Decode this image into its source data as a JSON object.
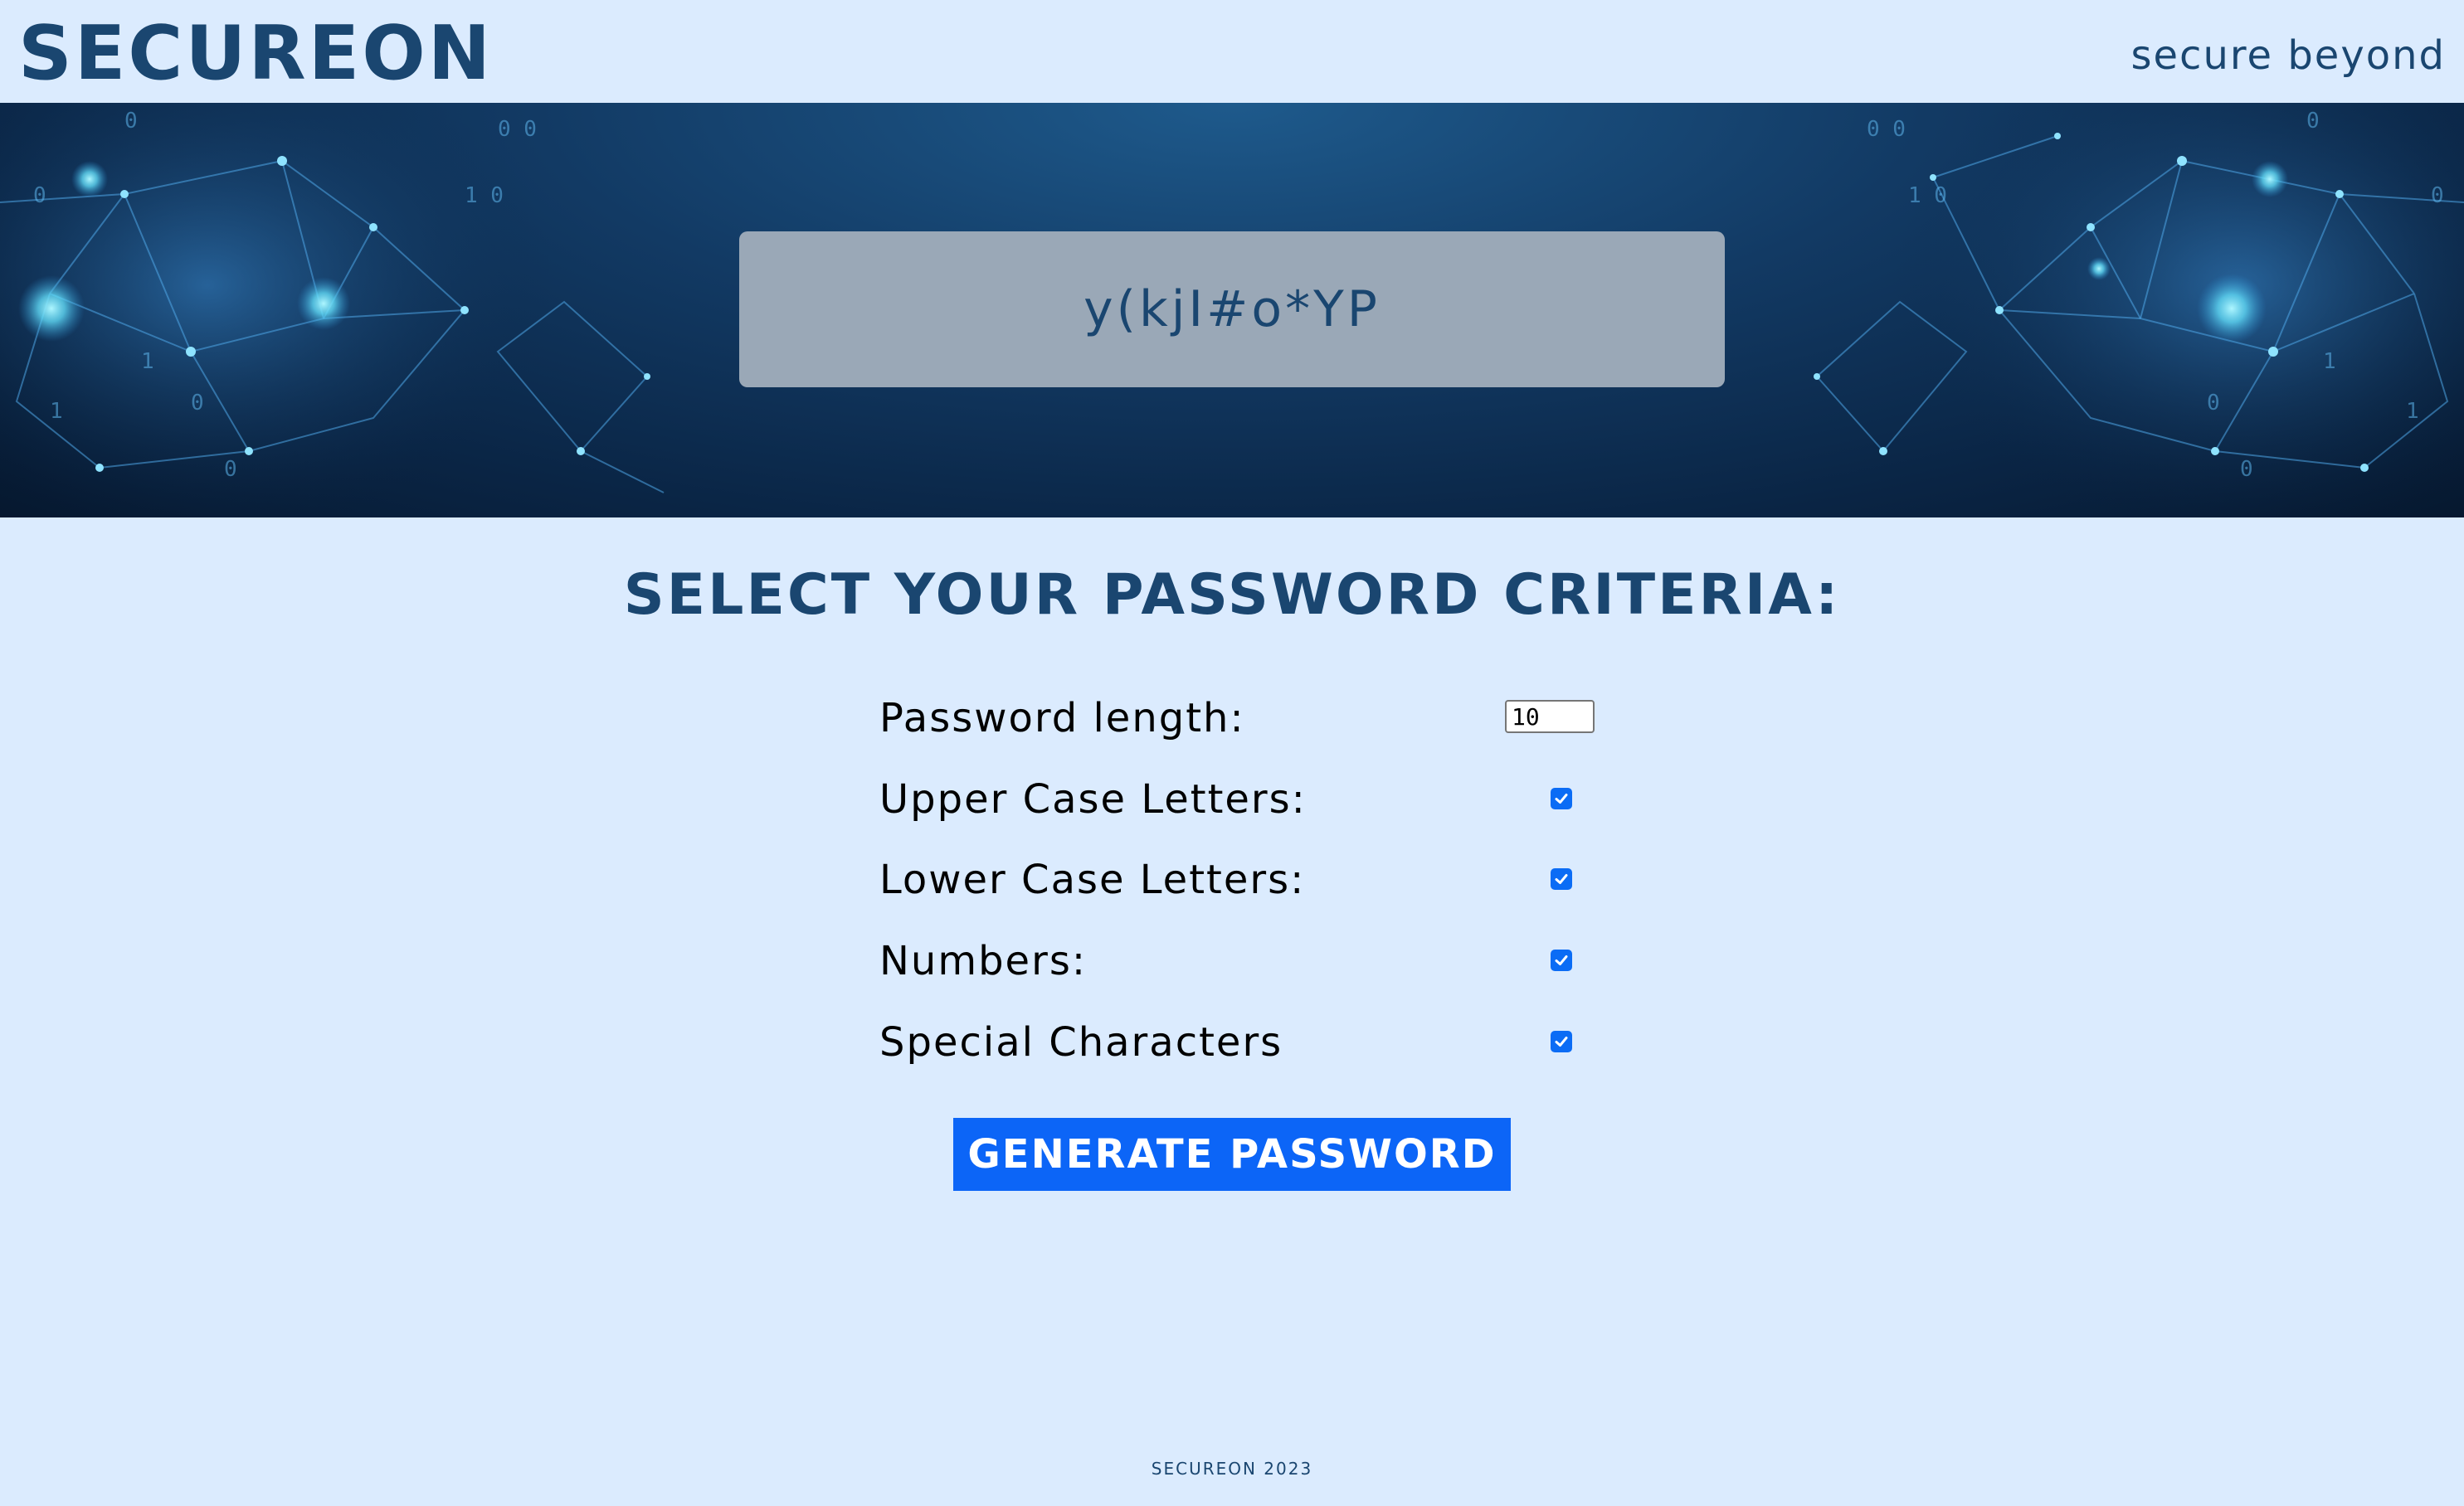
{
  "header": {
    "brand": "SECUREON",
    "tagline": "secure beyond"
  },
  "hero": {
    "generated_password": "y(kjI#o*YP"
  },
  "criteria": {
    "title": "SELECT YOUR PASSWORD CRITERIA:",
    "length": {
      "label": "Password length:",
      "value": "10"
    },
    "options": [
      {
        "label": "Upper Case Letters:",
        "checked": true
      },
      {
        "label": "Lower Case Letters:",
        "checked": true
      },
      {
        "label": "Numbers:",
        "checked": true
      },
      {
        "label": "Special Characters",
        "checked": true
      }
    ]
  },
  "actions": {
    "generate_label": "GENERATE PASSWORD"
  },
  "footer": {
    "text": "SECUREON 2023"
  },
  "colors": {
    "brand": "#1a4670",
    "background": "#dbebfe",
    "button": "#0c65f7",
    "checkbox": "#0b6cf5",
    "password_box": "#9aa8b7"
  }
}
